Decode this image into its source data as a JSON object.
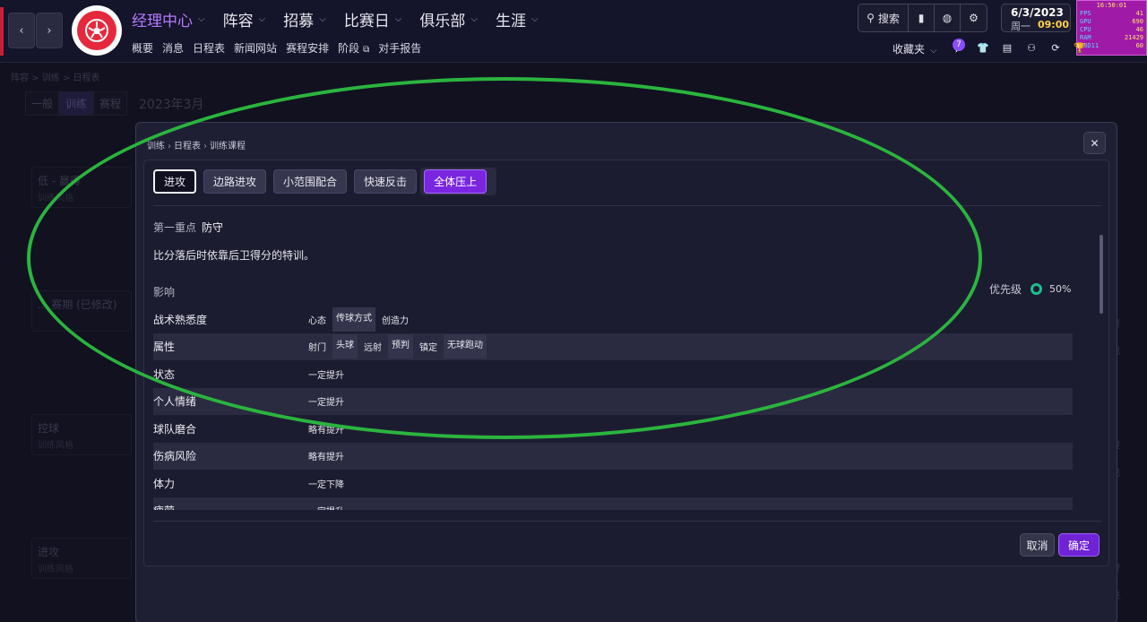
{
  "nav": {
    "back": "‹",
    "forward": "›",
    "main_items": [
      "经理中心",
      "阵容",
      "招募",
      "比赛日",
      "俱乐部",
      "生涯"
    ],
    "sub_items": [
      "概要",
      "消息",
      "日程表",
      "新闻网站",
      "赛程安排",
      "阶段",
      "对手报告"
    ]
  },
  "header": {
    "search_label": "搜索",
    "date": "6/3/2023",
    "weekday": "周一",
    "time": "09:00",
    "favorites": "收藏夹",
    "notifications_count": "7"
  },
  "hw": {
    "time": "16:50:01",
    "rows": [
      {
        "k": "FPS",
        "v": "41"
      },
      {
        "k": "GPU",
        "v": "690"
      },
      {
        "k": "CPU",
        "v": "46"
      },
      {
        "k": "RAM",
        "v": "21429"
      },
      {
        "k": "D3D11",
        "v": "60"
      }
    ]
  },
  "background": {
    "breadcrumb": "阵容 > 训练 > 日程表",
    "tabs": [
      "一般",
      "训练",
      "赛程"
    ],
    "month": "2023年3月",
    "cards": [
      {
        "a": "低 - 赢得",
        "b": "训练风格"
      },
      {
        "a": "... 赛期 (已修改)",
        "b": ""
      },
      {
        "a": "控球",
        "b": "训练风格"
      },
      {
        "a": "进攻",
        "b": "训练风格"
      }
    ],
    "right_labels": [
      "复",
      "息",
      "复",
      "息",
      "复",
      "息",
      "复",
      "息"
    ]
  },
  "modal": {
    "breadcrumb": [
      "训练",
      "日程表",
      "训练课程"
    ],
    "chips": [
      "进攻",
      "边路进攻",
      "小范围配合",
      "快速反击",
      "全体压上"
    ],
    "focus_label": "第一重点",
    "focus_value": "防守",
    "description": "比分落后时依靠后卫得分的特训。",
    "impact_label": "影响",
    "priority_label": "优先级",
    "priority_value": "50%",
    "priority_fraction": 0.5,
    "rows": [
      {
        "name": "战术熟悉度",
        "tags": [
          "心态",
          "传球方式",
          "创造力"
        ]
      },
      {
        "name": "属性",
        "tags": [
          "射门",
          "头球",
          "远射",
          "预判",
          "镇定",
          "无球跑动"
        ]
      },
      {
        "name": "状态",
        "tags": [
          "一定提升"
        ]
      },
      {
        "name": "个人情绪",
        "tags": [
          "一定提升"
        ]
      },
      {
        "name": "球队磨合",
        "tags": [
          "略有提升"
        ]
      },
      {
        "name": "伤病风险",
        "tags": [
          "略有提升"
        ]
      },
      {
        "name": "体力",
        "tags": [
          "一定下降"
        ]
      },
      {
        "name": "疲劳",
        "tags": [
          "一定提升"
        ]
      }
    ],
    "cancel": "取消",
    "confirm": "确定"
  },
  "colors": {
    "accent": "#7a26e0",
    "active_nav": "#b57bff",
    "annotation": "#2bb43e",
    "priority_ring": "#1dbf8e"
  }
}
